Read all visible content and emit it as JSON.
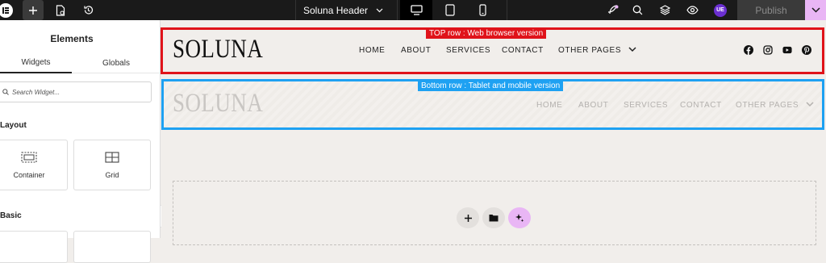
{
  "topbar": {
    "document_title": "Soluna Header",
    "publish_label": "Publish",
    "avatar_initials": "UE",
    "accent": "#e9b6f5"
  },
  "panel": {
    "title": "Elements",
    "tabs": [
      {
        "label": "Widgets"
      },
      {
        "label": "Globals"
      }
    ],
    "search_placeholder": "Search Widget...",
    "sections": [
      {
        "title": "Layout",
        "widgets": [
          {
            "label": "Container",
            "icon": "container-icon"
          },
          {
            "label": "Grid",
            "icon": "grid-icon"
          }
        ]
      },
      {
        "title": "Basic",
        "widgets": []
      }
    ]
  },
  "canvas": {
    "top_row": {
      "tag": "TOP row : Web browser version",
      "logo": "SOLUNA",
      "nav": [
        "HOME",
        "ABOUT",
        "SERVICES",
        "CONTACT",
        "OTHER PAGES"
      ],
      "social_icons": [
        "facebook-icon",
        "instagram-icon",
        "youtube-icon",
        "pinterest-icon"
      ],
      "border_color": "#e0131a"
    },
    "bottom_row": {
      "tag": "Bottom row : Tablet and mobile version",
      "logo": "SOLUNA",
      "nav": [
        "HOME",
        "ABOUT",
        "SERVICES",
        "CONTACT",
        "OTHER PAGES"
      ],
      "border_color": "#1ea1f2"
    }
  }
}
